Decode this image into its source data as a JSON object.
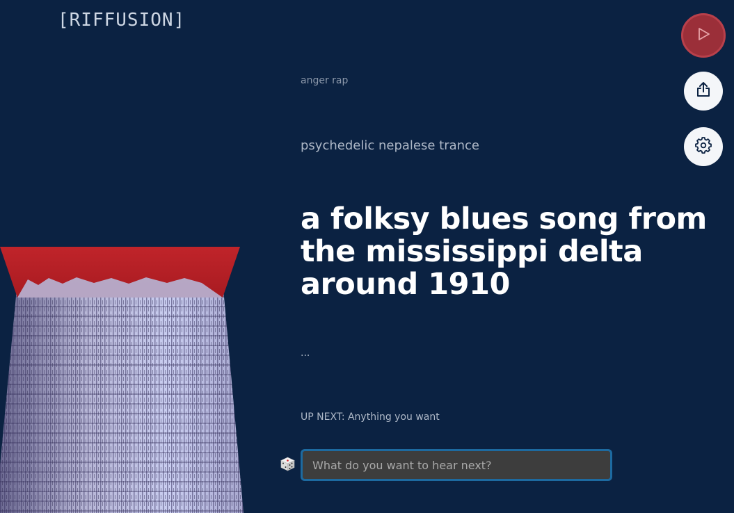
{
  "app": {
    "logo": "[RIFFUSION]"
  },
  "prompts": {
    "older_2": "anger rap",
    "older_1": "psychedelic nepalese trance",
    "current": "a folksy blues song from the mississippi delta around 1910",
    "upcoming_placeholder": "..."
  },
  "up_next": {
    "label": "UP NEXT: Anything you want"
  },
  "input": {
    "placeholder": "What do you want to hear next?",
    "value": ""
  },
  "buttons": {
    "play_icon": "play-icon",
    "share_icon": "share-icon",
    "settings_icon": "gear-icon",
    "dice_icon": "dice-icon"
  },
  "colors": {
    "background": "#0b2242",
    "accent_red": "#b51f24",
    "play_button": "#9b2f39",
    "input_border": "#1d6aa0"
  }
}
